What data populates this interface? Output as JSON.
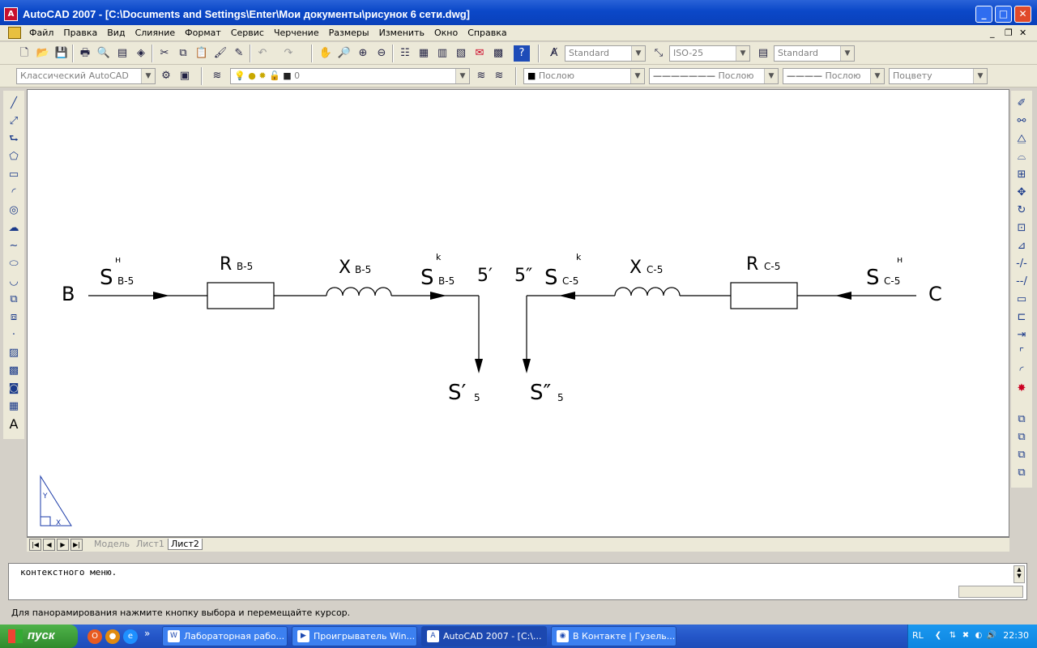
{
  "window": {
    "app_icon": "A",
    "title": "AutoCAD 2007 - [C:\\Documents and Settings\\Enter\\Мои документы\\рисунок 6 сети.dwg]",
    "buttons": {
      "minimize": "_",
      "maximize": "□",
      "close": "✕"
    }
  },
  "menu": {
    "items": [
      "Файл",
      "Правка",
      "Вид",
      "Слияние",
      "Формат",
      "Сервис",
      "Черчение",
      "Размеры",
      "Изменить",
      "Окно",
      "Справка"
    ],
    "doc_controls": {
      "minimize": "_",
      "restore": "❐",
      "close": "✕"
    }
  },
  "toolbar_standard": {
    "icons": [
      "new-icon",
      "open-icon",
      "save-icon",
      "print-icon",
      "preview-icon",
      "publish-icon",
      "3d-print-icon",
      "cut-icon",
      "copy-icon",
      "paste-icon",
      "match-icon",
      "block-edit-icon",
      "undo-icon",
      "redo-icon",
      "pan-icon",
      "zoom-realtime-icon",
      "zoom-window-icon",
      "zoom-previous-icon",
      "properties-icon",
      "design-center-icon",
      "tool-palettes-icon",
      "sheet-set-icon",
      "markup-icon",
      "calculator-icon",
      "help-icon"
    ],
    "text_style": "Standard",
    "dim_style": "ISO-25",
    "table_style": "Standard"
  },
  "toolbar_layers": {
    "workspace": "Классический AutoCAD",
    "layer": "0",
    "color": "Послою",
    "linetype": "Послою",
    "lineweight": "Послою",
    "plotstyle": "Поцвету"
  },
  "drawing": {
    "node_B": "B",
    "node_C": "C",
    "label_S": "S",
    "sup_n": "н",
    "sup_k": "k",
    "sub_B5": "В-5",
    "sub_C5": "С-5",
    "label_R": "R",
    "label_X": "X",
    "node_5p": "5′",
    "node_5pp": "5″",
    "load_S5p": "S′",
    "load_S5pp": "S″",
    "sub_5": "5",
    "ucs_y": "Y",
    "ucs_x": "X"
  },
  "layout_tabs": [
    "Модель",
    "Лист1",
    "Лист2"
  ],
  "active_tab": "Лист2",
  "command": {
    "line": "контекстного меню.",
    "status": "Для панорамирования нажмите кнопку выбора и перемещайте курсор."
  },
  "taskbar": {
    "start": "пуск",
    "tasks": [
      {
        "label": "Лабораторная рабо...",
        "active": false
      },
      {
        "label": "Проигрыватель Win...",
        "active": false
      },
      {
        "label": "AutoCAD 2007 - [C:\\...",
        "active": true
      },
      {
        "label": "В Контакте | Гузель...",
        "active": false
      }
    ],
    "lang": "RL",
    "clock": "22:30",
    "quicklaunch_more": "»"
  }
}
